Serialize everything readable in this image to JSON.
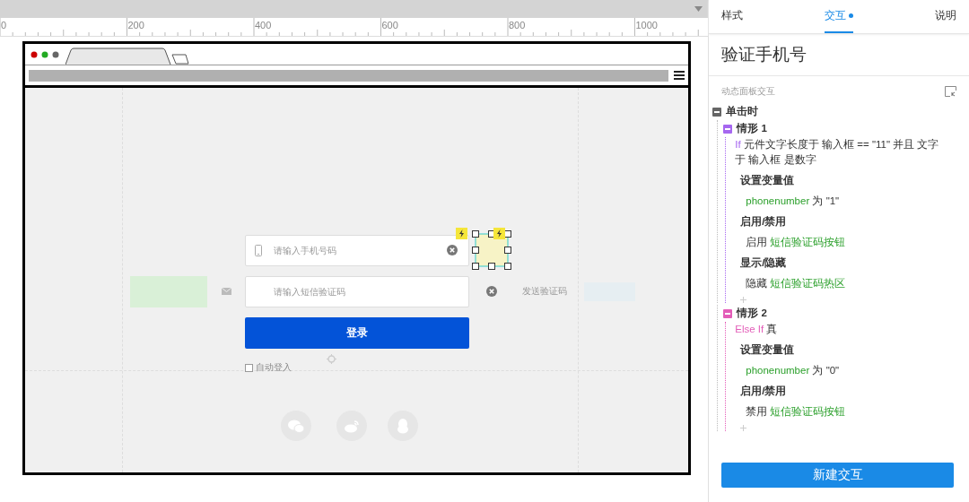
{
  "ruler": {
    "labels": [
      "0",
      "200",
      "400",
      "600",
      "800",
      "1000"
    ]
  },
  "canvas": {
    "phone_field": {
      "placeholder": "请输入手机号码"
    },
    "sms_field": {
      "placeholder": "请输入短信验证码"
    },
    "send_code": "发送验证码",
    "login_button": "登录",
    "auto_login": {
      "label": "自动登入",
      "checked": false
    },
    "hotspot": {
      "selected": true
    }
  },
  "panel": {
    "tabs": [
      {
        "label": "样式",
        "selected": false,
        "dot": false
      },
      {
        "label": "交互",
        "selected": true,
        "dot": true
      },
      {
        "label": "说明",
        "selected": false,
        "dot": false
      }
    ],
    "title": "验证手机号",
    "section_label": "动态面板交互",
    "event": {
      "label": "单击时",
      "expanded": true,
      "cases": [
        {
          "label": "情形 1",
          "color": "#a667f0",
          "expanded": true,
          "keyword": "If",
          "condition": "元件文字长度于 输入框 == \"11\" 并且 文字于 输入框 是数字",
          "actions": [
            {
              "title": "设置变量值",
              "items": [
                [
                  {
                    "kind": "target",
                    "text": "phonenumber"
                  },
                  {
                    "kind": "plain",
                    "text": " 为 \"1\""
                  }
                ]
              ]
            },
            {
              "title": "启用/禁用",
              "items": [
                [
                  {
                    "kind": "plain",
                    "text": "启用 "
                  },
                  {
                    "kind": "target",
                    "text": "短信验证码按钮"
                  }
                ]
              ]
            },
            {
              "title": "显示/隐藏",
              "items": [
                [
                  {
                    "kind": "plain",
                    "text": "隐藏 "
                  },
                  {
                    "kind": "target",
                    "text": "短信验证码热区"
                  }
                ]
              ]
            }
          ]
        },
        {
          "label": "情形 2",
          "color": "#e35db8",
          "expanded": true,
          "keyword": "Else If",
          "condition": "真",
          "actions": [
            {
              "title": "设置变量值",
              "items": [
                [
                  {
                    "kind": "target",
                    "text": "phonenumber"
                  },
                  {
                    "kind": "plain",
                    "text": " 为 \"0\""
                  }
                ]
              ]
            },
            {
              "title": "启用/禁用",
              "items": [
                [
                  {
                    "kind": "plain",
                    "text": "禁用 "
                  },
                  {
                    "kind": "target",
                    "text": "短信验证码按钮"
                  }
                ]
              ]
            }
          ]
        }
      ]
    },
    "new_button": "新建交互"
  }
}
